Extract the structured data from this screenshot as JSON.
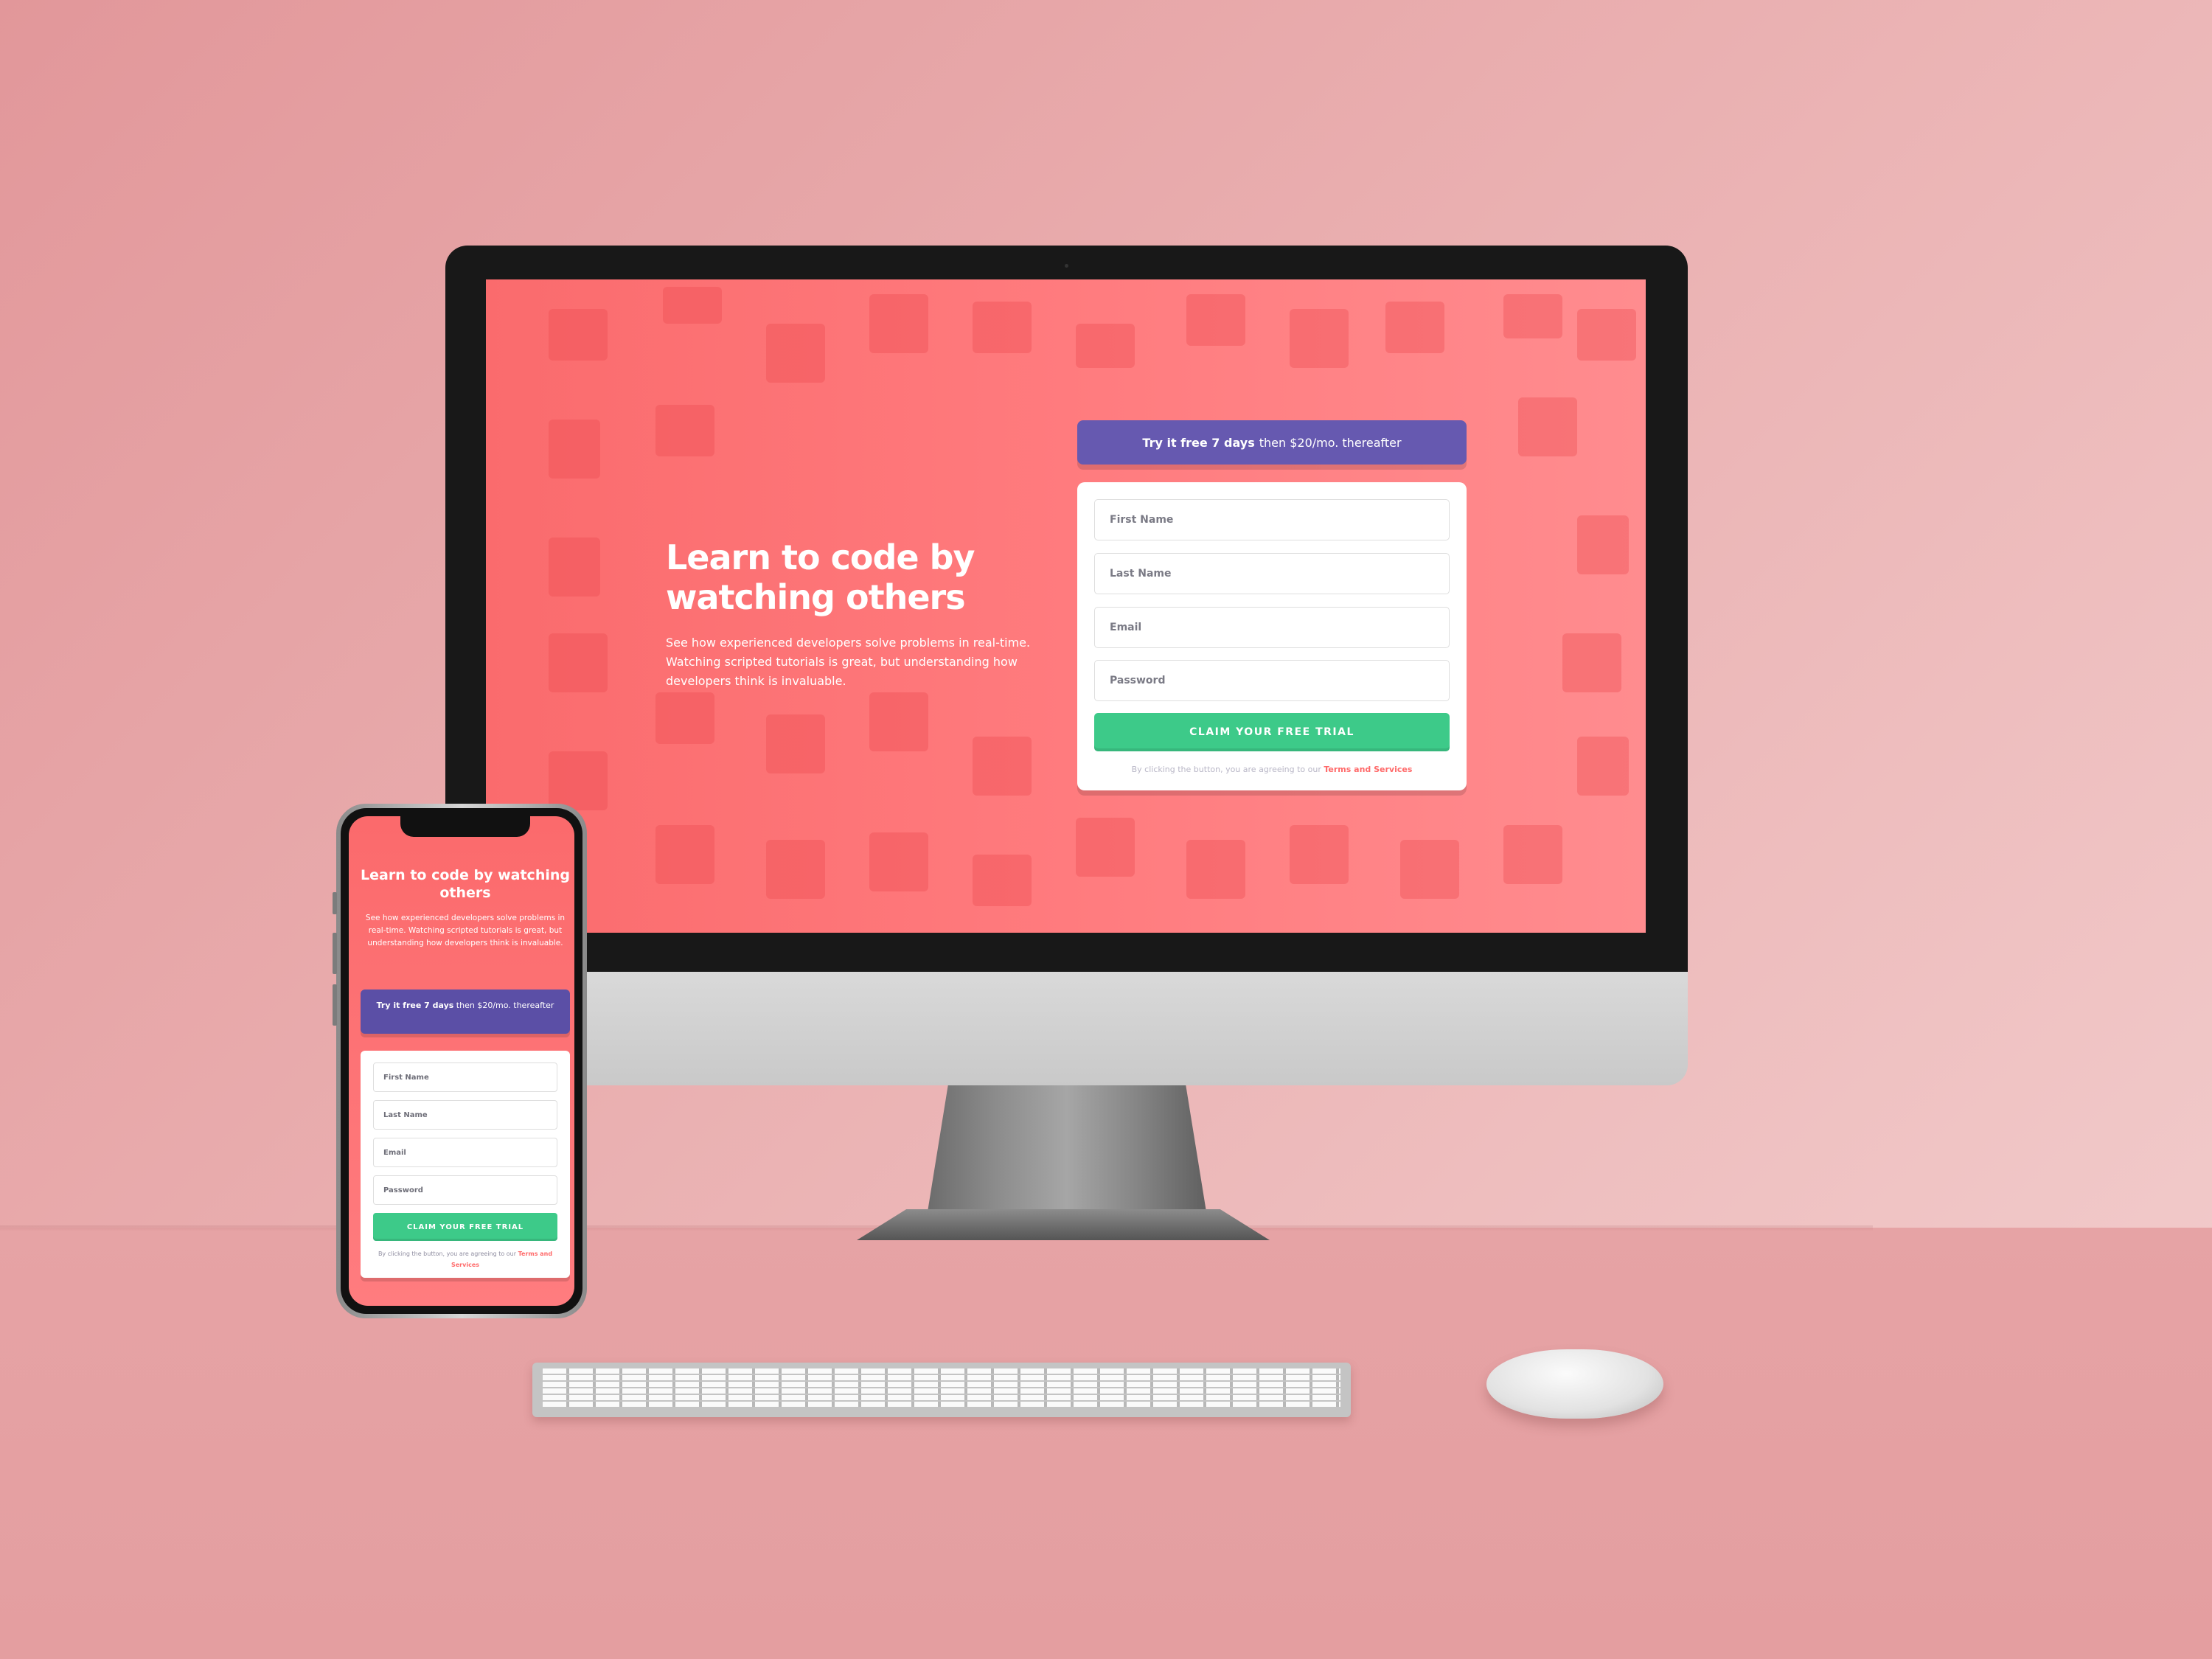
{
  "desktop": {
    "hero": {
      "title": "Learn to code by watching others",
      "description": "See how experienced developers solve problems in real-time. Watching scripted tutorials is great, but understanding how developers think is invaluable."
    },
    "promo": {
      "bold": "Try it free 7 days",
      "rest": "then $20/mo. thereafter"
    },
    "form": {
      "first_name_placeholder": "First Name",
      "last_name_placeholder": "Last Name",
      "email_placeholder": "Email",
      "password_placeholder": "Password",
      "submit_label": "CLAIM YOUR FREE TRIAL",
      "legal_text": "By clicking the button, you are agreeing to our",
      "legal_link": "Terms and Services"
    }
  },
  "mobile": {
    "hero": {
      "title": "Learn to code by watching others",
      "description": "See how experienced developers solve problems in real-time. Watching scripted tutorials is great, but understanding how developers think is invaluable."
    },
    "promo": {
      "bold": "Try it free 7 days",
      "rest": "then $20/mo. thereafter"
    },
    "form": {
      "first_name_placeholder": "First Name",
      "last_name_placeholder": "Last Name",
      "email_placeholder": "Email",
      "password_placeholder": "Password",
      "submit_label": "CLAIM YOUR FREE TRIAL",
      "legal_text": "By clicking the button, you are agreeing to our",
      "legal_link": "Terms and Services"
    }
  },
  "colors": {
    "page_background": "#ff7a7c",
    "promo_purple": "#6659b0",
    "button_green": "#3dca89",
    "link_red": "#ff6a6a"
  },
  "icons": {
    "background_pattern": "coding-illustration-pattern",
    "keyboard": "keyboard",
    "mouse": "mouse"
  }
}
